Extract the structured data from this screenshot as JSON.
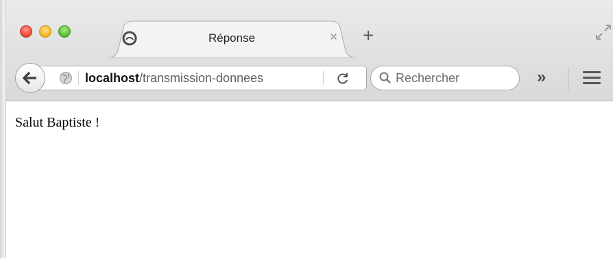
{
  "tab": {
    "title": "Réponse",
    "close_glyph": "×",
    "icon": "globe-tab-icon"
  },
  "new_tab_glyph": "+",
  "navbar": {
    "back_icon": "back-arrow-icon",
    "site_icon": "globe-icon",
    "url_host": "localhost",
    "url_path": "/transmission-donnees",
    "reload_glyph": "C",
    "search_placeholder": "Rechercher",
    "overflow_glyph": "»",
    "menu_icon": "hamburger-menu-icon"
  },
  "content": {
    "text": "Salut Baptiste !"
  },
  "colors": {
    "chrome_top": "#eaeaea",
    "chrome_bottom": "#d9d9d9",
    "close_red": "#ee4c3e",
    "minimize_yellow": "#f6b92b",
    "zoom_green": "#62c23a"
  }
}
